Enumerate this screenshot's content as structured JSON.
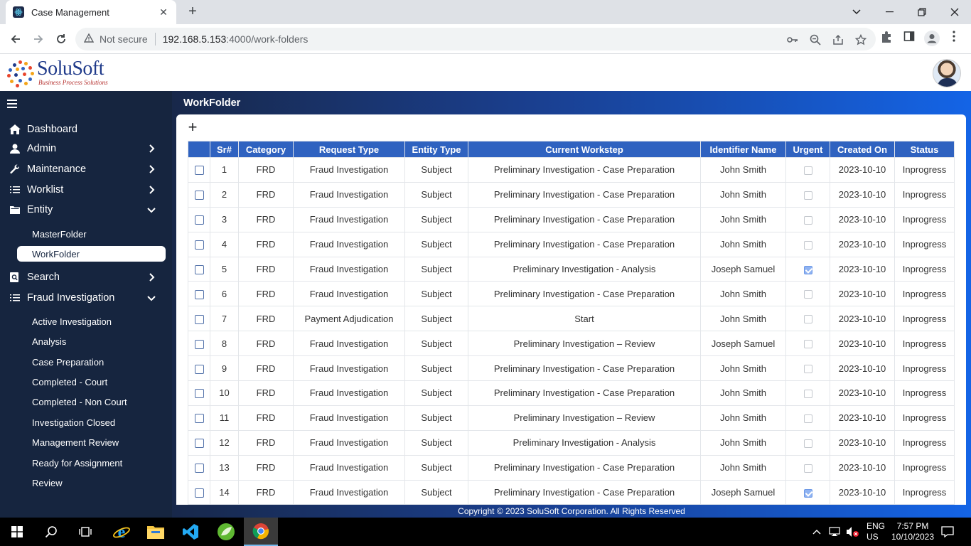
{
  "browser": {
    "tab_title": "Case Management",
    "security_label": "Not secure",
    "url_host": "192.168.5.153",
    "url_path": ":4000/work-folders"
  },
  "app": {
    "logo_brand": "SoluSoft",
    "logo_tagline": "Business Process Solutions",
    "page_heading": "WorkFolder",
    "footer": "Copyright © 2023 SoluSoft Corporation. All Rights Reserved"
  },
  "sidebar": {
    "menu": [
      {
        "label": "Dashboard",
        "icon": "home-icon"
      },
      {
        "label": "Admin",
        "icon": "user-icon"
      },
      {
        "label": "Maintenance",
        "icon": "wrench-icon"
      },
      {
        "label": "Worklist",
        "icon": "list-icon"
      },
      {
        "label": "Entity",
        "icon": "folder-icon"
      },
      {
        "label": "Search",
        "icon": "search-doc-icon"
      },
      {
        "label": "Fraud Investigation",
        "icon": "list-icon"
      }
    ],
    "entity_sub": [
      "MasterFolder",
      "WorkFolder"
    ],
    "fraud_sub": [
      "Active Investigation",
      "Analysis",
      "Case Preparation",
      "Completed - Court",
      "Completed - Non Court",
      "Investigation Closed",
      "Management Review",
      "Ready for Assignment",
      "Review"
    ]
  },
  "table": {
    "headers": [
      "",
      "Sr#",
      "Category",
      "Request Type",
      "Entity Type",
      "Current Workstep",
      "Identifier Name",
      "Urgent",
      "Created On",
      "Status"
    ],
    "rows": [
      {
        "sr": "1",
        "category": "FRD",
        "request_type": "Fraud Investigation",
        "entity_type": "Subject",
        "workstep": "Preliminary Investigation - Case Preparation",
        "identifier": "John Smith",
        "urgent": false,
        "created": "2023-10-10",
        "status": "Inprogress"
      },
      {
        "sr": "2",
        "category": "FRD",
        "request_type": "Fraud Investigation",
        "entity_type": "Subject",
        "workstep": "Preliminary Investigation - Case Preparation",
        "identifier": "John Smith",
        "urgent": false,
        "created": "2023-10-10",
        "status": "Inprogress"
      },
      {
        "sr": "3",
        "category": "FRD",
        "request_type": "Fraud Investigation",
        "entity_type": "Subject",
        "workstep": "Preliminary Investigation - Case Preparation",
        "identifier": "John Smith",
        "urgent": false,
        "created": "2023-10-10",
        "status": "Inprogress"
      },
      {
        "sr": "4",
        "category": "FRD",
        "request_type": "Fraud Investigation",
        "entity_type": "Subject",
        "workstep": "Preliminary Investigation - Case Preparation",
        "identifier": "John Smith",
        "urgent": false,
        "created": "2023-10-10",
        "status": "Inprogress"
      },
      {
        "sr": "5",
        "category": "FRD",
        "request_type": "Fraud Investigation",
        "entity_type": "Subject",
        "workstep": "Preliminary Investigation - Analysis",
        "identifier": "Joseph Samuel",
        "urgent": true,
        "created": "2023-10-10",
        "status": "Inprogress"
      },
      {
        "sr": "6",
        "category": "FRD",
        "request_type": "Fraud Investigation",
        "entity_type": "Subject",
        "workstep": "Preliminary Investigation - Case Preparation",
        "identifier": "John Smith",
        "urgent": false,
        "created": "2023-10-10",
        "status": "Inprogress"
      },
      {
        "sr": "7",
        "category": "FRD",
        "request_type": "Payment Adjudication",
        "entity_type": "Subject",
        "workstep": "Start",
        "identifier": "John Smith",
        "urgent": false,
        "created": "2023-10-10",
        "status": "Inprogress"
      },
      {
        "sr": "8",
        "category": "FRD",
        "request_type": "Fraud Investigation",
        "entity_type": "Subject",
        "workstep": "Preliminary Investigation – Review",
        "identifier": "Joseph Samuel",
        "urgent": false,
        "created": "2023-10-10",
        "status": "Inprogress"
      },
      {
        "sr": "9",
        "category": "FRD",
        "request_type": "Fraud Investigation",
        "entity_type": "Subject",
        "workstep": "Preliminary Investigation - Case Preparation",
        "identifier": "John Smith",
        "urgent": false,
        "created": "2023-10-10",
        "status": "Inprogress"
      },
      {
        "sr": "10",
        "category": "FRD",
        "request_type": "Fraud Investigation",
        "entity_type": "Subject",
        "workstep": "Preliminary Investigation - Case Preparation",
        "identifier": "John Smith",
        "urgent": false,
        "created": "2023-10-10",
        "status": "Inprogress"
      },
      {
        "sr": "11",
        "category": "FRD",
        "request_type": "Fraud Investigation",
        "entity_type": "Subject",
        "workstep": "Preliminary Investigation – Review",
        "identifier": "John Smith",
        "urgent": false,
        "created": "2023-10-10",
        "status": "Inprogress"
      },
      {
        "sr": "12",
        "category": "FRD",
        "request_type": "Fraud Investigation",
        "entity_type": "Subject",
        "workstep": "Preliminary Investigation - Analysis",
        "identifier": "John Smith",
        "urgent": false,
        "created": "2023-10-10",
        "status": "Inprogress"
      },
      {
        "sr": "13",
        "category": "FRD",
        "request_type": "Fraud Investigation",
        "entity_type": "Subject",
        "workstep": "Preliminary Investigation - Case Preparation",
        "identifier": "John Smith",
        "urgent": false,
        "created": "2023-10-10",
        "status": "Inprogress"
      },
      {
        "sr": "14",
        "category": "FRD",
        "request_type": "Fraud Investigation",
        "entity_type": "Subject",
        "workstep": "Preliminary Investigation - Case Preparation",
        "identifier": "Joseph Samuel",
        "urgent": true,
        "created": "2023-10-10",
        "status": "Inprogress"
      }
    ]
  },
  "taskbar": {
    "lang_top": "ENG",
    "lang_bottom": "US",
    "time": "7:57 PM",
    "date": "10/10/2023"
  },
  "colors": {
    "sidebar_bg": "#16253f",
    "header_row": "#2f62c0",
    "accent_blue": "#1464e6"
  }
}
